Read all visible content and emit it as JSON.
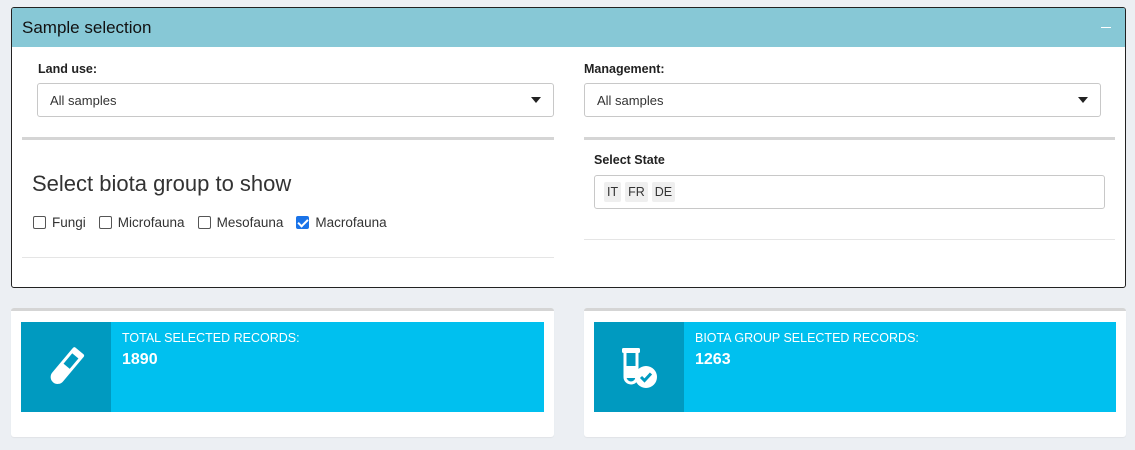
{
  "panel": {
    "title": "Sample selection",
    "collapse_icon": "minus-icon"
  },
  "land_use": {
    "label": "Land use:",
    "value": "All samples"
  },
  "management": {
    "label": "Management:",
    "value": "All samples"
  },
  "biota": {
    "title": "Select biota group to show",
    "options": [
      {
        "label": "Fungi",
        "checked": false
      },
      {
        "label": "Microfauna",
        "checked": false
      },
      {
        "label": "Mesofauna",
        "checked": false
      },
      {
        "label": "Macrofauna",
        "checked": true
      }
    ]
  },
  "state": {
    "label": "Select State",
    "chips": [
      "IT",
      "FR",
      "DE"
    ]
  },
  "boxes": {
    "total": {
      "icon": "test-tube-icon",
      "text": "TOTAL SELECTED RECORDS:",
      "value": "1890"
    },
    "biota": {
      "icon": "vial-check-icon",
      "text": "BIOTA GROUP SELECTED RECORDS:",
      "value": "1263"
    }
  },
  "colors": {
    "header": "#87c8d6",
    "info_box": "#00c0ef",
    "info_icon_bg": "#009ac0"
  }
}
